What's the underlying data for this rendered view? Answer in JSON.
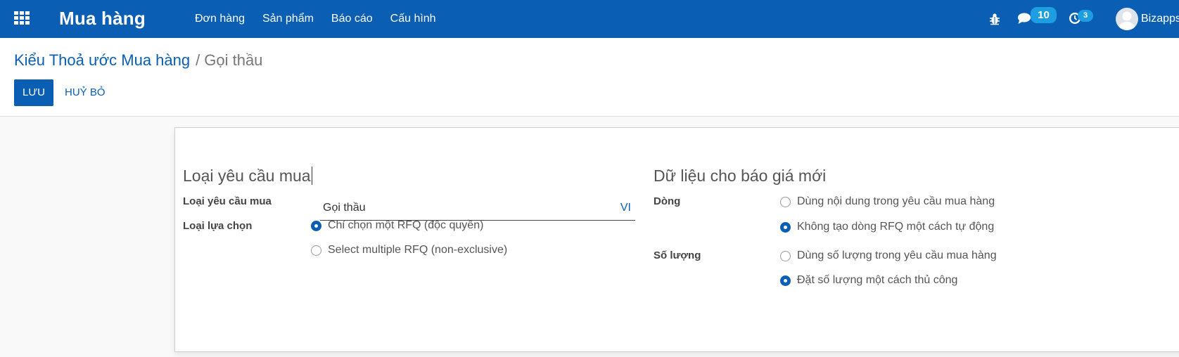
{
  "navbar": {
    "app_title": "Mua hàng",
    "menu": [
      "Đơn hàng",
      "Sản phẩm",
      "Báo cáo",
      "Cấu hình"
    ],
    "chat_count": "10",
    "activity_count": "3",
    "user_name": "Bizapps",
    "color": "#0a5fb4"
  },
  "breadcrumb": {
    "parent": "Kiểu Thoả ước Mua hàng",
    "separator": "/",
    "current": "Gọi thầu"
  },
  "buttons": {
    "save": "LƯU",
    "discard": "HUỶ BỎ"
  },
  "form": {
    "left_group": {
      "title": "Loại yêu cầu mua",
      "name_label": "Loại yêu cầu mua",
      "name_value": "Gọi thầu",
      "lang": "VI",
      "selection_label": "Loại lựa chọn",
      "selection_options": [
        {
          "label": "Chỉ chọn một RFQ (độc quyền)",
          "checked": true
        },
        {
          "label": "Select multiple RFQ (non-exclusive)",
          "checked": false
        }
      ]
    },
    "right_group": {
      "title": "Dữ liệu cho báo giá mới",
      "lines_label": "Dòng",
      "lines_options": [
        {
          "label": "Dùng nội dung trong yêu cầu mua hàng",
          "checked": false
        },
        {
          "label": "Không tạo dòng RFQ một cách tự động",
          "checked": true
        }
      ],
      "quantity_label": "Số lượng",
      "quantity_options": [
        {
          "label": "Dùng số lượng trong yêu cầu mua hàng",
          "checked": false
        },
        {
          "label": "Đặt số lượng một cách thủ công",
          "checked": true
        }
      ]
    }
  }
}
